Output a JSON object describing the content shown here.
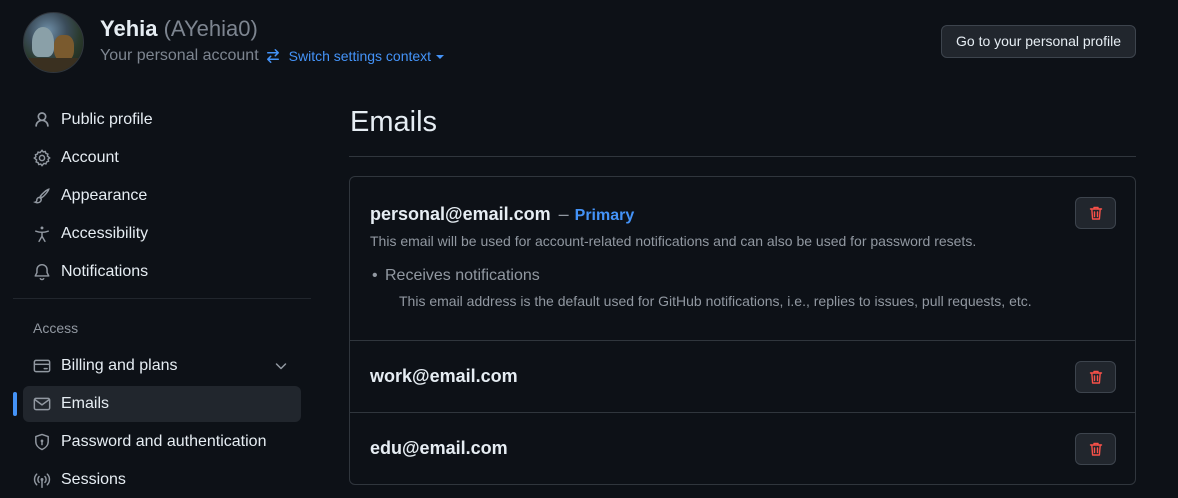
{
  "header": {
    "name": "Yehia",
    "handle": "(AYehia0)",
    "context": "Your personal account",
    "switch_label": "Switch settings context",
    "profile_button": "Go to your personal profile"
  },
  "sidebar": {
    "items": [
      {
        "label": "Public profile",
        "icon": "person-icon"
      },
      {
        "label": "Account",
        "icon": "gear-icon"
      },
      {
        "label": "Appearance",
        "icon": "paintbrush-icon"
      },
      {
        "label": "Accessibility",
        "icon": "accessibility-icon"
      },
      {
        "label": "Notifications",
        "icon": "bell-icon"
      }
    ],
    "access_heading": "Access",
    "access_items": [
      {
        "label": "Billing and plans",
        "icon": "credit-card-icon",
        "expandable": true
      },
      {
        "label": "Emails",
        "icon": "mail-icon",
        "active": true
      },
      {
        "label": "Password and authentication",
        "icon": "shield-lock-icon"
      },
      {
        "label": "Sessions",
        "icon": "broadcast-icon"
      }
    ]
  },
  "main": {
    "title": "Emails",
    "emails": [
      {
        "address": "personal@email.com",
        "dash": "–",
        "badge": "Primary",
        "description": "This email will be used for account-related notifications and can also be used for password resets.",
        "bullet_title": "Receives notifications",
        "bullet_desc": "This email address is the default used for GitHub notifications, i.e., replies to issues, pull requests, etc."
      },
      {
        "address": "work@email.com"
      },
      {
        "address": "edu@email.com"
      }
    ]
  },
  "colors": {
    "background": "#0d1117",
    "accent": "#4493f8",
    "danger": "#f85149",
    "text": "#e6edf3",
    "muted": "#9198a1"
  }
}
